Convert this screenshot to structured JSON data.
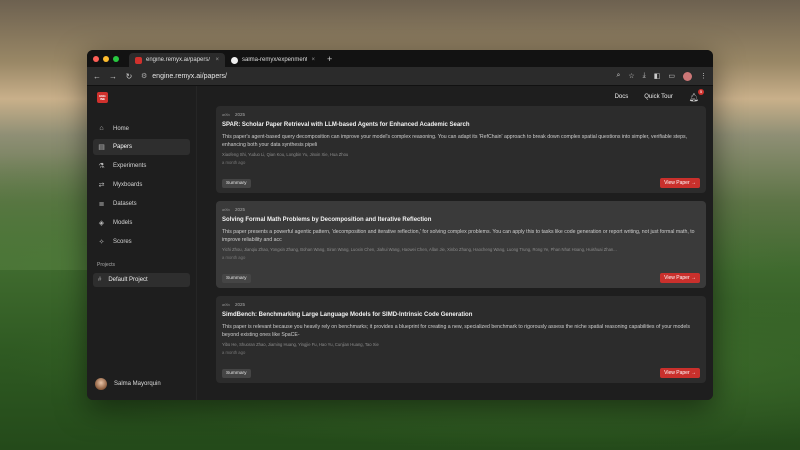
{
  "browser": {
    "tabs": [
      {
        "title": "engine.remyx.ai/papers/",
        "close": "×"
      },
      {
        "title": "salma-remyx/experimental-v",
        "close": "×"
      }
    ],
    "new_tab": "+",
    "url": "engine.remyx.ai/papers/",
    "nav": {
      "back": "←",
      "forward": "→",
      "reload": "↻"
    }
  },
  "sidebar": {
    "logo_text": "ENG INE",
    "items": [
      {
        "label": "Home",
        "icon": "home-icon",
        "glyph": "⌂"
      },
      {
        "label": "Papers",
        "icon": "papers-icon",
        "glyph": "▤"
      },
      {
        "label": "Experiments",
        "icon": "experiments-icon",
        "glyph": "⚗"
      },
      {
        "label": "Myxboards",
        "icon": "myxboards-icon",
        "glyph": "⇄"
      },
      {
        "label": "Datasets",
        "icon": "datasets-icon",
        "glyph": "≣"
      },
      {
        "label": "Models",
        "icon": "models-icon",
        "glyph": "◈"
      },
      {
        "label": "Scores",
        "icon": "scores-icon",
        "glyph": "✧"
      }
    ],
    "projects_label": "Projects",
    "project": {
      "label": "Default Project",
      "glyph": "#"
    },
    "user_name": "Salma Mayorquin"
  },
  "topnav": {
    "docs": "Docs",
    "tour": "Quick Tour",
    "notification_count": "5"
  },
  "papers": [
    {
      "source": "arXiv",
      "year": "2025",
      "title": "SPAR: Scholar Paper Retrieval with LLM-based Agents for Enhanced Academic Search",
      "description": "This paper's agent-based query decomposition can improve your model's complex reasoning. You can adapt its 'RefChain' approach to break down complex spatial questions into simpler, verifiable steps, enhancing both your data synthesis pipeli",
      "authors": "Xiaofeng Shi, Yuduo Li, Qian Kou, Longbin Yu, Jinxin Xie, Hua Zhou",
      "age": "a month ago",
      "summary": "Summary",
      "view": "View Paper →"
    },
    {
      "source": "arXiv",
      "year": "2025",
      "title": "Solving Formal Math Problems by Decomposition and Iterative Reflection",
      "description": "This paper presents a powerful agentic pattern, 'decomposition and iterative reflection,' for solving complex problems. You can apply this to tasks like code generation or report writing, not just formal math, to improve reliability and acc",
      "authors": "Yichi Zhou, Jianqiu Zhao, Yongxin Zhang, Bohan Wang, Siran Wang, Luoxin Chen, Jiahui Wang, Haowei Chen, Allan Jie, Xinbo Zhang, Haocheng Wang, Luong Trung, Rong Ye, Phan Nhat Hoang, Huishuai Zhan...",
      "age": "a month ago",
      "summary": "Summary",
      "view": "View Paper →"
    },
    {
      "source": "arXiv",
      "year": "2025",
      "title": "SimdBench: Benchmarking Large Language Models for SIMD-Intrinsic Code Generation",
      "description": "This paper is relevant because you heavily rely on benchmarks; it provides a blueprint for creating a new, specialized benchmark to rigorously assess the niche spatial reasoning capabilities of your models beyond existing ones like SpaCE-",
      "authors": "Yibo He, Shuoran Zhao, Jiaming Huang, Yingjie Fu, Hao Yu, Cunjian Huang, Tao Xie",
      "age": "a month ago",
      "summary": "Summary",
      "view": "View Paper →"
    }
  ]
}
